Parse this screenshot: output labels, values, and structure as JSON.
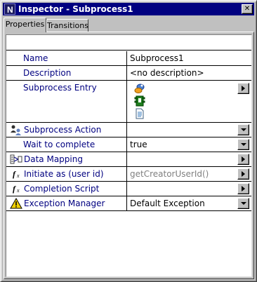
{
  "window": {
    "title": "Inspector - Subprocess1",
    "close_glyph": "✕"
  },
  "tabs": [
    {
      "label": "Properties",
      "active": true
    },
    {
      "label": "Transitions",
      "active": false
    }
  ],
  "properties": {
    "name": {
      "label": "Name",
      "value": "Subprocess1"
    },
    "description": {
      "label": "Description",
      "value": "<no description>"
    },
    "subprocess_entry": {
      "label": "Subprocess Entry",
      "icons": [
        "process-link-icon",
        "component-icon",
        "document-icon"
      ]
    },
    "subprocess_action": {
      "label": "Subprocess Action",
      "value": "",
      "icon": "people-action-icon",
      "control": "dropdown"
    },
    "wait_to_complete": {
      "label": "Wait to complete",
      "value": "true",
      "control": "dropdown"
    },
    "data_mapping": {
      "label": "Data Mapping",
      "value": "",
      "icon": "data-mapping-icon",
      "control": "button"
    },
    "initiate_as": {
      "label": "Initiate as (user id)",
      "value": "getCreatorUserId()",
      "icon": "function-icon",
      "control": "button"
    },
    "completion_script": {
      "label": "Completion Script",
      "value": "",
      "icon": "function-icon",
      "control": "button"
    },
    "exception_manager": {
      "label": "Exception Manager",
      "value": "Default Exception",
      "icon": "warning-icon",
      "control": "dropdown"
    }
  },
  "colors": {
    "titlebar": "#000080",
    "label_text": "#000080",
    "face": "#c0c0c0",
    "muted_value": "#808080"
  }
}
